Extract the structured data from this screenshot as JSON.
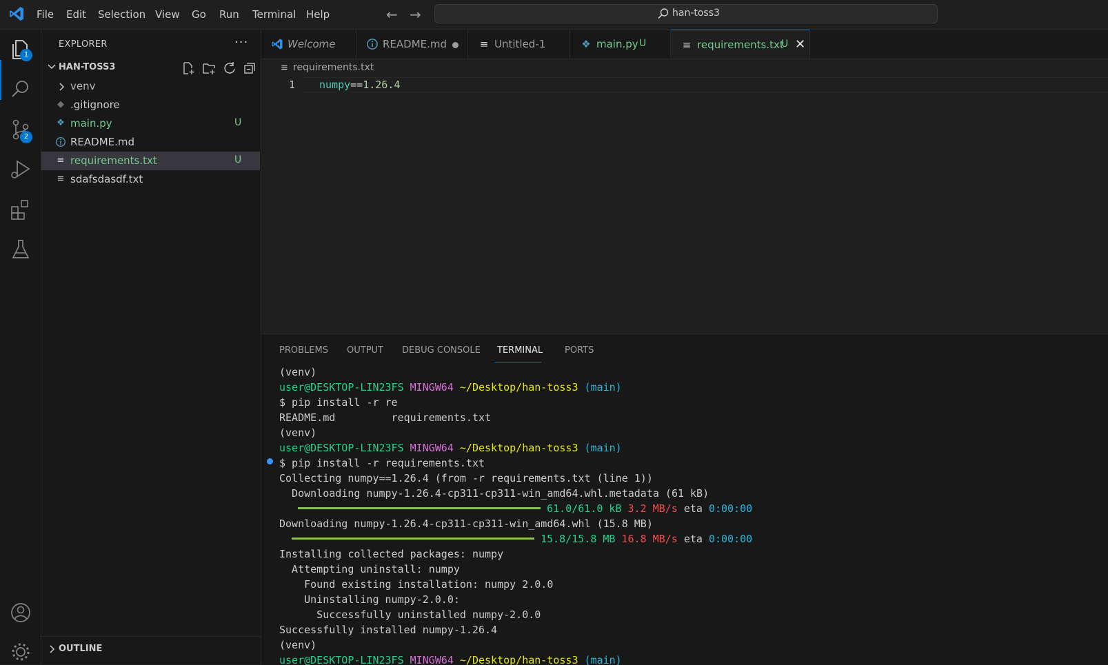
{
  "menubar": {
    "items": [
      "File",
      "Edit",
      "Selection",
      "View",
      "Go",
      "Run",
      "Terminal",
      "Help"
    ],
    "search_label": "han-toss3"
  },
  "activitybar": {
    "explorer_badge": "1",
    "scm_badge": "2"
  },
  "sidebar": {
    "title": "EXPLORER",
    "folder": "HAN-TOSS3",
    "files": [
      {
        "label": "venv",
        "status": ""
      },
      {
        "label": ".gitignore",
        "status": ""
      },
      {
        "label": "main.py",
        "status": "U"
      },
      {
        "label": "README.md",
        "status": ""
      },
      {
        "label": "requirements.txt",
        "status": "U"
      },
      {
        "label": "sdafsdasdf.txt",
        "status": ""
      }
    ],
    "outline_label": "OUTLINE"
  },
  "tabs": [
    {
      "label": "Welcome",
      "status": ""
    },
    {
      "label": "README.md",
      "status": ""
    },
    {
      "label": "Untitled-1",
      "status": ""
    },
    {
      "label": "main.py",
      "status": "U"
    },
    {
      "label": "requirements.txt",
      "status": "U"
    }
  ],
  "editor": {
    "breadcrumb": "requirements.txt",
    "line_number": "1",
    "code": {
      "pkg": "numpy",
      "op": "==",
      "ver": "1.26.4"
    }
  },
  "panel": {
    "tabs": [
      "PROBLEMS",
      "OUTPUT",
      "DEBUG CONSOLE",
      "TERMINAL",
      "PORTS"
    ],
    "terminal": {
      "venv": "(venv)",
      "user": "user@DESKTOP-LIN23FS",
      "env": "MINGW64",
      "path": "~/Desktop/han-toss3",
      "branch": "(main)",
      "cmd1": "$ pip install -r re",
      "completion": "README.md         requirements.txt",
      "cmd2": "$ pip install -r requirements.txt",
      "collecting": "Collecting numpy==1.26.4 (from -r requirements.txt (line 1))",
      "dl_meta": "  Downloading numpy-1.26.4-cp311-cp311-win_amd64.whl.metadata (61 kB)",
      "meta_size": "61.0/61.0 kB",
      "meta_speed": "3.2 MB/s",
      "meta_eta_label": "eta",
      "meta_eta": "0:00:00",
      "dl_whl": "Downloading numpy-1.26.4-cp311-cp311-win_amd64.whl (15.8 MB)",
      "whl_size": "15.8/15.8 MB",
      "whl_speed": "16.8 MB/s",
      "whl_eta_label": "eta",
      "whl_eta": "0:00:00",
      "installing": "Installing collected packages: numpy",
      "attempting": "  Attempting uninstall: numpy",
      "found": "    Found existing installation: numpy 2.0.0",
      "uninstalling": "    Uninstalling numpy-2.0.0:",
      "uninstalled": "      Successfully uninstalled numpy-2.0.0",
      "installed": "Successfully installed numpy-1.26.4",
      "progress_meta": 1.0,
      "progress_whl": 1.0
    }
  },
  "colors": {
    "accent": "#0078d4",
    "untracked": "#73c991",
    "progress": "#8bc34a"
  }
}
